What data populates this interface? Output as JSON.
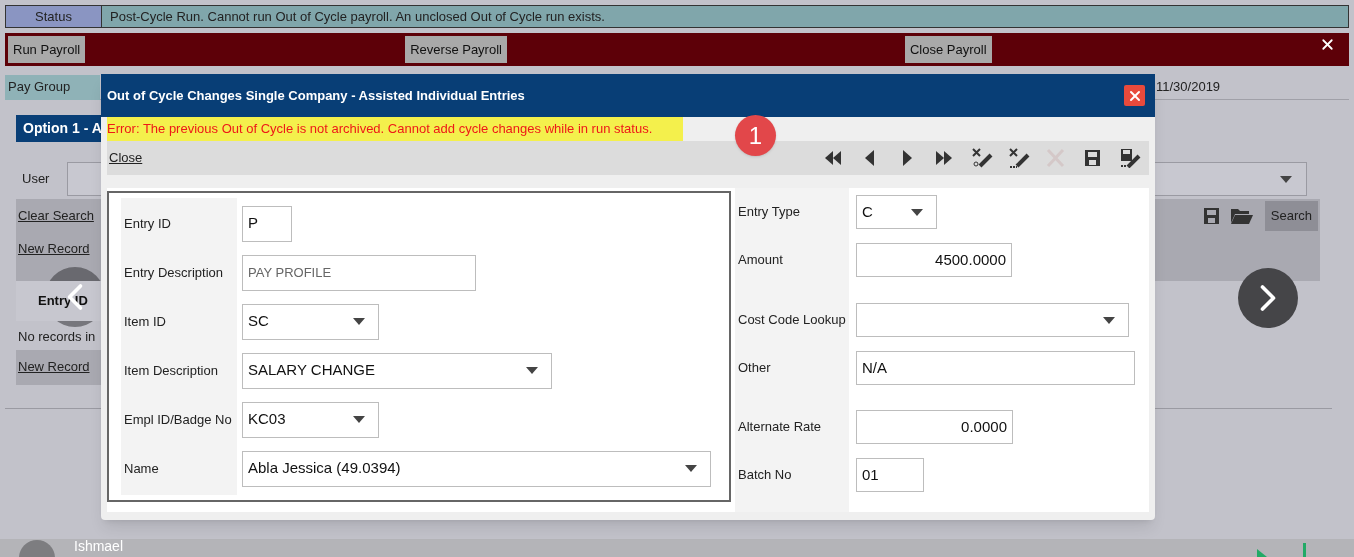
{
  "status": {
    "label": "Status",
    "message": "Post-Cycle Run. Cannot run Out of Cycle payroll. An unclosed Out of Cycle run exists."
  },
  "action_bar": {
    "buttons": [
      "Run Payroll",
      "Reverse Payroll",
      "Close Payroll"
    ]
  },
  "pay_group": {
    "label": "Pay Group",
    "date": "11/30/2019"
  },
  "option_header": "Option 1 - A",
  "user_filter": {
    "label": "User"
  },
  "search_panel": {
    "clear_link": "Clear Search",
    "search_button": "Search"
  },
  "records": {
    "new_record_links": [
      "New Record",
      "New Record"
    ],
    "column": "Entry ID",
    "empty_text": "No records in"
  },
  "modal": {
    "title": "Out of Cycle Changes Single Company - Assisted Individual Entries",
    "error": "Error: The previous Out of Cycle is not archived. Cannot add cycle changes while in run status.",
    "step_badge": "1",
    "close_link": "Close",
    "toolbar": [
      {
        "kind": "first",
        "disabled": false
      },
      {
        "kind": "prev",
        "disabled": false
      },
      {
        "kind": "next",
        "disabled": false
      },
      {
        "kind": "last",
        "disabled": false
      },
      {
        "kind": "clear-new",
        "disabled": false
      },
      {
        "kind": "clear",
        "disabled": false
      },
      {
        "kind": "delete",
        "disabled": true
      },
      {
        "kind": "save",
        "disabled": false
      },
      {
        "kind": "save-edit",
        "disabled": false
      }
    ],
    "left_fields": [
      {
        "label": "Entry ID",
        "kind": "input",
        "value": "P",
        "disabled": false
      },
      {
        "label": "Entry Description",
        "kind": "input",
        "value": "PAY PROFILE",
        "disabled": true
      },
      {
        "label": "Item ID",
        "kind": "select",
        "value": "SC",
        "disabled": false
      },
      {
        "label": "Item Description",
        "kind": "select",
        "value": "SALARY CHANGE",
        "disabled": false
      },
      {
        "label": "Empl ID/Badge No",
        "kind": "select",
        "value": "KC03",
        "disabled": false
      },
      {
        "label": "Name",
        "kind": "select",
        "value": "Abla Jessica  (49.0394)",
        "disabled": false
      }
    ],
    "right_fields": [
      {
        "label": "Entry Type",
        "kind": "select",
        "value": "C"
      },
      {
        "label": "Amount",
        "kind": "number",
        "value": "4500.0000"
      },
      {
        "label": "Cost Code Lookup",
        "kind": "select"
      },
      {
        "label": "Other",
        "kind": "input",
        "value": "N/A"
      },
      {
        "label": "Alternate Rate",
        "kind": "number",
        "value": "0.0000"
      },
      {
        "label": "Batch No",
        "kind": "input",
        "value": "01"
      }
    ]
  },
  "footer": {
    "user_name": "Ishmael"
  }
}
